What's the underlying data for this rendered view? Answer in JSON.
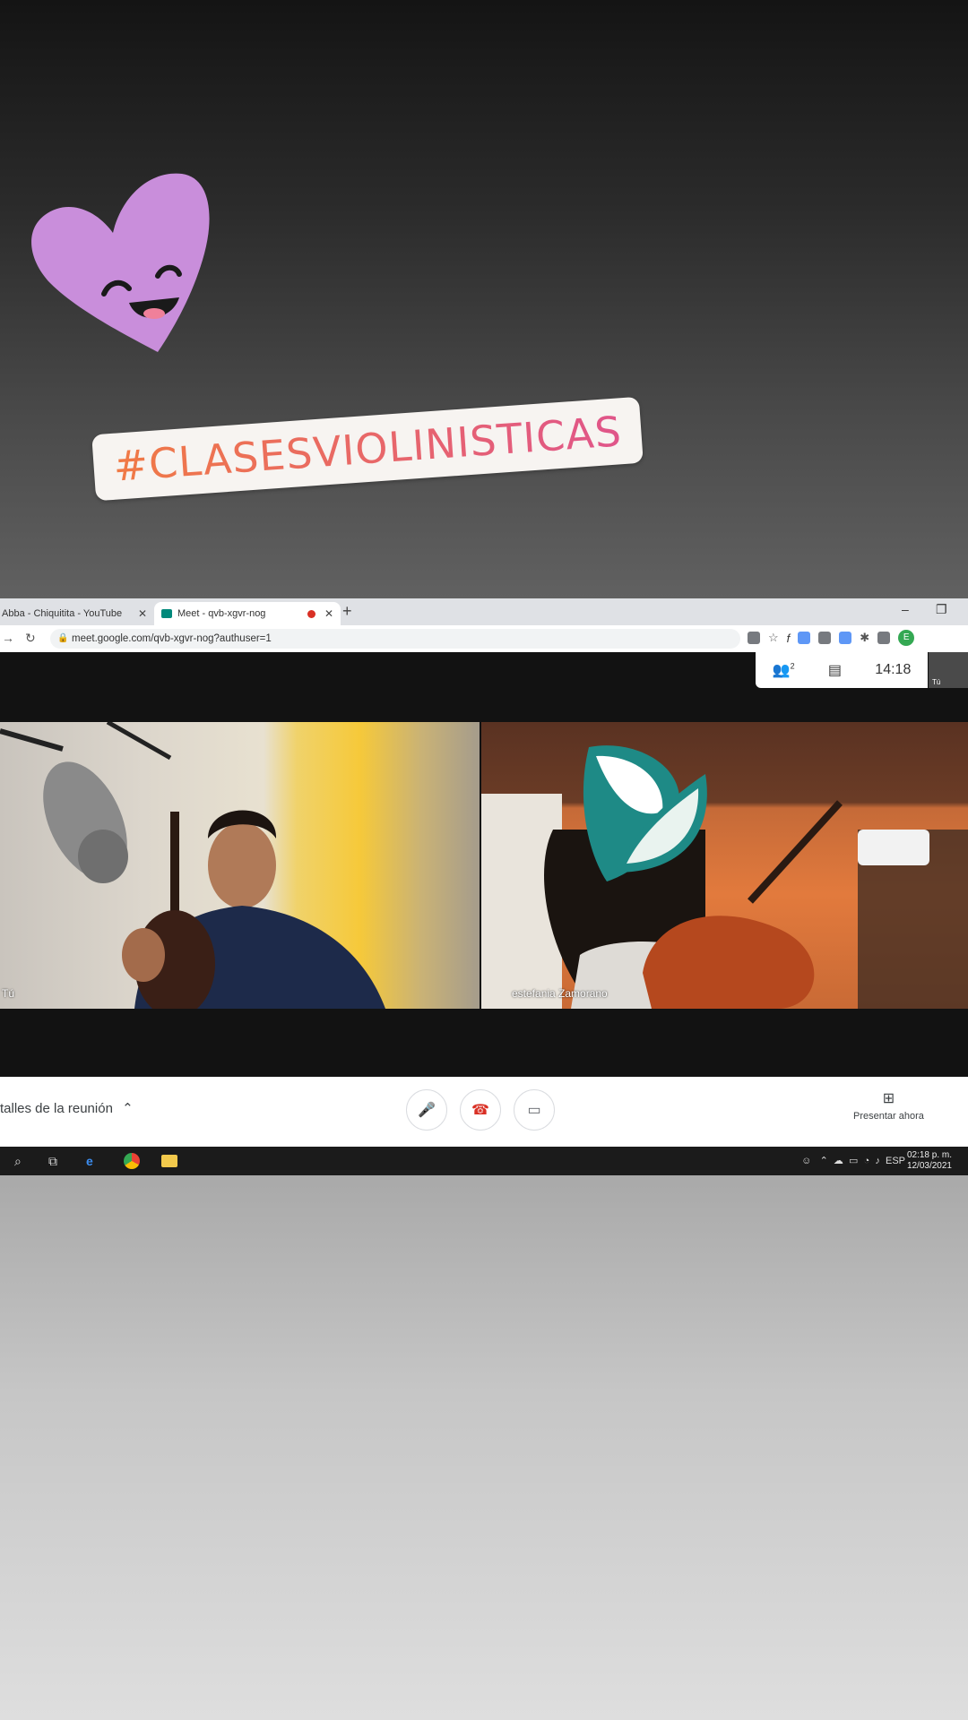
{
  "story": {
    "hashtag": "#CLASESVIOLINISTICAS",
    "sticker": "happy-heart-sticker",
    "colors": {
      "heart": "#c98edb",
      "hashtag_start": "#f07a45",
      "hashtag_end": "#e0558a"
    }
  },
  "browser": {
    "tabs": [
      {
        "label": "Abba - Chiquitita - YouTube",
        "close": "✕"
      },
      {
        "label": "Meet - qvb-xgvr-nog",
        "close": "✕"
      }
    ],
    "new_tab": "+",
    "minimize": "–",
    "restore": "❐",
    "url": "meet.google.com/qvb-xgvr-nog?authuser=1",
    "profile_initial": "E"
  },
  "meet": {
    "participants_count": "2",
    "clock": "14:18",
    "self_thumb_label": "Tú",
    "left_video_label": "Tú",
    "right_video_label": "estefania Zamorano",
    "meeting_details": "talles de la reunión",
    "present_label": "Presentar ahora"
  },
  "taskbar": {
    "language": "ESP",
    "time": "02:18 p. m.",
    "date": "12/03/2021"
  }
}
